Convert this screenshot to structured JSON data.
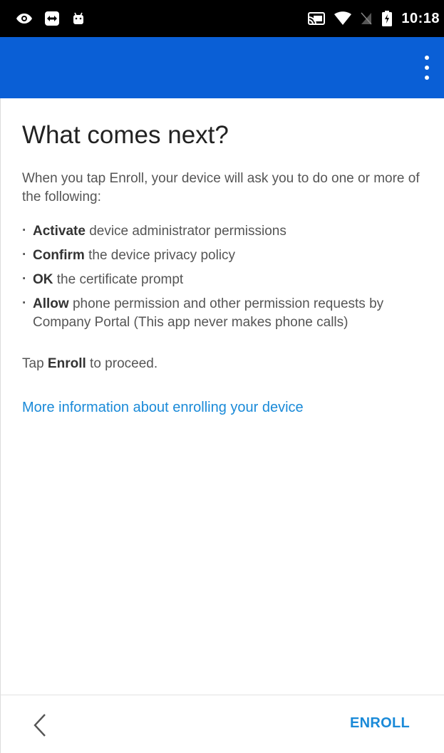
{
  "status_bar": {
    "time": "10:18",
    "left_icons": [
      "eye-icon",
      "teamviewer-icon",
      "android-icon"
    ],
    "right_icons": [
      "cast-icon",
      "wifi-icon",
      "no-sim-icon",
      "battery-icon"
    ]
  },
  "app_bar": {
    "color": "#0a5fd6",
    "menu_icon": "overflow-menu-icon"
  },
  "main": {
    "title": "What comes next?",
    "intro": "When you tap Enroll, your device will ask you to do one or more of the following:",
    "steps": [
      {
        "bold": "Activate",
        "text": " device administrator permissions"
      },
      {
        "bold": "Confirm",
        "text": " the device privacy policy"
      },
      {
        "bold": "OK",
        "text": " the certificate prompt"
      },
      {
        "bold": "Allow",
        "text": " phone permission and other permission requests by Company Portal (This app never makes phone calls)"
      }
    ],
    "proceed": {
      "prefix": "Tap ",
      "bold": "Enroll",
      "suffix": " to proceed."
    },
    "link": "More information about enrolling your device",
    "link_color": "#1a8ad8"
  },
  "bottom_bar": {
    "back_icon": "chevron-left-icon",
    "enroll_label": "ENROLL"
  }
}
